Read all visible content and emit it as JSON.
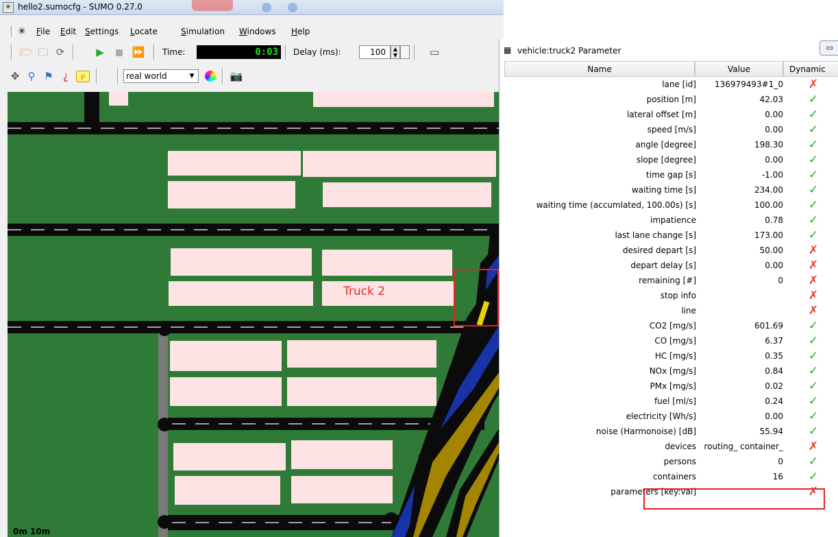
{
  "window": {
    "title": "hello2.sumocfg - SUMO 0.27.0"
  },
  "menu": [
    "File",
    "Edit",
    "Settings",
    "Locate",
    "Simulation",
    "Windows",
    "Help"
  ],
  "toolbar": {
    "time_label": "Time:",
    "time_value": "0:03",
    "delay_label": "Delay (ms):",
    "delay_value": "100"
  },
  "view": {
    "scheme": "real world"
  },
  "map": {
    "truck_label": "Truck 2",
    "scale_label": "0m 10m"
  },
  "dialog": {
    "title": "vehicle:truck2 Parameter",
    "columns": [
      "Name",
      "Value",
      "Dynamic"
    ],
    "rows": [
      {
        "name": "lane [id]",
        "value": "136979493#1_0",
        "dynamic": false
      },
      {
        "name": "position [m]",
        "value": "42.03",
        "dynamic": true
      },
      {
        "name": "lateral offset [m]",
        "value": "0.00",
        "dynamic": true
      },
      {
        "name": "speed [m/s]",
        "value": "0.00",
        "dynamic": true
      },
      {
        "name": "angle [degree]",
        "value": "198.30",
        "dynamic": true
      },
      {
        "name": "slope [degree]",
        "value": "0.00",
        "dynamic": true
      },
      {
        "name": "time gap [s]",
        "value": "-1.00",
        "dynamic": true
      },
      {
        "name": "waiting time [s]",
        "value": "234.00",
        "dynamic": true
      },
      {
        "name": "waiting time (accumlated, 100.00s) [s]",
        "value": "100.00",
        "dynamic": true
      },
      {
        "name": "impatience",
        "value": "0.78",
        "dynamic": true
      },
      {
        "name": "last lane change [s]",
        "value": "173.00",
        "dynamic": true
      },
      {
        "name": "desired depart [s]",
        "value": "50.00",
        "dynamic": false
      },
      {
        "name": "depart delay [s]",
        "value": "0.00",
        "dynamic": false
      },
      {
        "name": "remaining [#]",
        "value": "0",
        "dynamic": false
      },
      {
        "name": "stop info",
        "value": "",
        "dynamic": false
      },
      {
        "name": "line",
        "value": "",
        "dynamic": false
      },
      {
        "name": "CO2 [mg/s]",
        "value": "601.69",
        "dynamic": true
      },
      {
        "name": "CO [mg/s]",
        "value": "6.37",
        "dynamic": true
      },
      {
        "name": "HC [mg/s]",
        "value": "0.35",
        "dynamic": true
      },
      {
        "name": "NOx [mg/s]",
        "value": "0.84",
        "dynamic": true
      },
      {
        "name": "PMx [mg/s]",
        "value": "0.02",
        "dynamic": true
      },
      {
        "name": "fuel [ml/s]",
        "value": "0.24",
        "dynamic": true
      },
      {
        "name": "electricity [Wh/s]",
        "value": "0.00",
        "dynamic": true
      },
      {
        "name": "noise (Harmonoise) [dB]",
        "value": "55.94",
        "dynamic": true
      },
      {
        "name": "devices",
        "value": "routing_ container_",
        "dynamic": false
      },
      {
        "name": "persons",
        "value": "0",
        "dynamic": true
      },
      {
        "name": "containers",
        "value": "16",
        "dynamic": true
      },
      {
        "name": "parameters [key:val]",
        "value": "",
        "dynamic": false
      }
    ]
  },
  "icons": {
    "dynamic_yes": "check-icon",
    "dynamic_no": "cross-icon"
  },
  "colors": {
    "map_background": "#2f7a36",
    "building": "#fde3e3",
    "road": "#0b0b0b",
    "highlight": "#e52020",
    "check": "#29a52a",
    "cross": "#e23a2a"
  }
}
